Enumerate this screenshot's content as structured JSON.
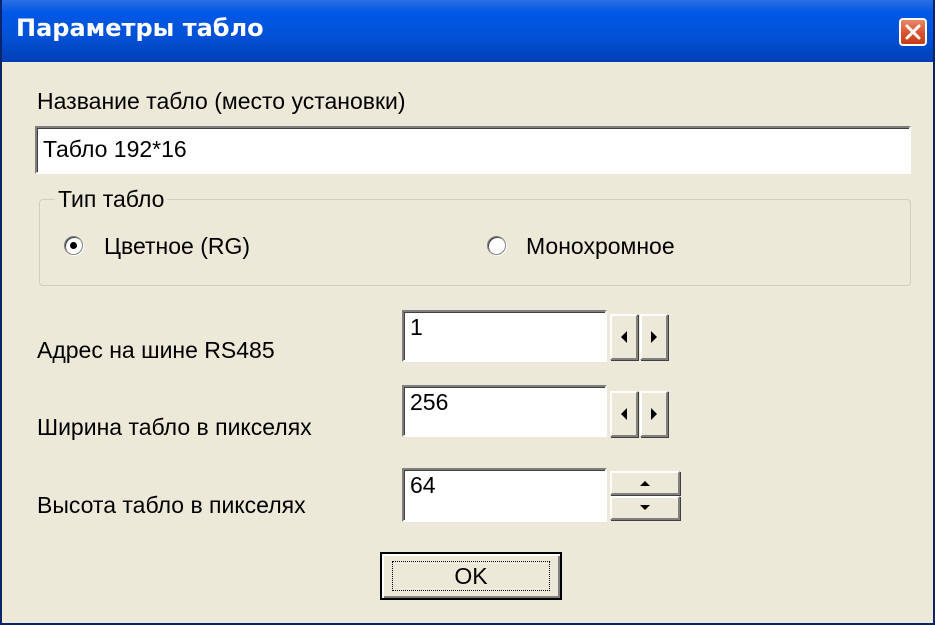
{
  "window": {
    "title": "Параметры табло",
    "close_icon": "close-icon"
  },
  "name_section": {
    "label": "Название табло (место установки)",
    "value": "Табло 192*16"
  },
  "type_group": {
    "legend": "Тип табло",
    "options": [
      {
        "label": "Цветное (RG)",
        "selected": true
      },
      {
        "label": "Монохромное",
        "selected": false
      }
    ]
  },
  "fields": {
    "address": {
      "label": "Адрес на шине RS485",
      "value": "1"
    },
    "width": {
      "label": "Ширина табло в пикселях",
      "value": "256"
    },
    "height": {
      "label": "Высота табло в пикселях",
      "value": "64"
    }
  },
  "buttons": {
    "ok_label": "OK"
  },
  "colors": {
    "titlebar": "#0058e6",
    "dialog_background": "#ece9d8",
    "close_button": "#d7532e"
  }
}
